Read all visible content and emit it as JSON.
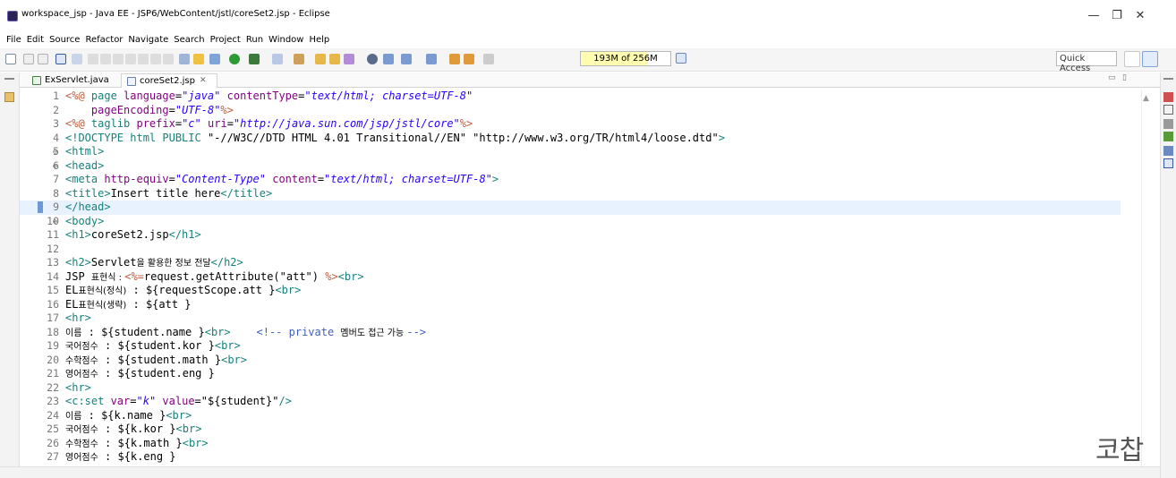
{
  "window": {
    "title": "workspace_jsp - Java EE - JSP6/WebContent/jstl/coreSet2.jsp - Eclipse",
    "minimize": "—",
    "maximize": "❐",
    "close": "✕"
  },
  "menu": [
    "File",
    "Edit",
    "Source",
    "Refactor",
    "Navigate",
    "Search",
    "Project",
    "Run",
    "Window",
    "Help"
  ],
  "toolbar": {
    "heap_status": "193M of 256M",
    "heap_fraction": 0.754,
    "quick_access": "Quick Access"
  },
  "tabs": [
    {
      "label": "ExServlet.java",
      "icon": "java-file-icon",
      "active": false
    },
    {
      "label": "coreSet2.jsp",
      "icon": "jsp-file-icon",
      "active": true,
      "close": "✕"
    }
  ],
  "editor": {
    "current_line": 9,
    "lines": [
      {
        "n": "1",
        "fold": "",
        "tokens": [
          [
            "jsp",
            "<%@ "
          ],
          [
            "tag",
            "page "
          ],
          [
            "attr",
            "language"
          ],
          [
            "plain",
            "="
          ],
          [
            "str",
            "\"java\""
          ],
          [
            "plain",
            " "
          ],
          [
            "attr",
            "contentType"
          ],
          [
            "plain",
            "="
          ],
          [
            "str",
            "\"text/html; charset=UTF-8\""
          ]
        ]
      },
      {
        "n": "2",
        "fold": "",
        "tokens": [
          [
            "plain",
            "    "
          ],
          [
            "attr",
            "pageEncoding"
          ],
          [
            "plain",
            "="
          ],
          [
            "str",
            "\"UTF-8\""
          ],
          [
            "jsp",
            "%>"
          ]
        ]
      },
      {
        "n": "3",
        "fold": "",
        "tokens": [
          [
            "jsp",
            "<%@ "
          ],
          [
            "tag",
            "taglib "
          ],
          [
            "attr",
            "prefix"
          ],
          [
            "plain",
            "="
          ],
          [
            "str",
            "\"c\""
          ],
          [
            "plain",
            " "
          ],
          [
            "attr",
            "uri"
          ],
          [
            "plain",
            "="
          ],
          [
            "str",
            "\"http://java.sun.com/jsp/jstl/core\""
          ],
          [
            "jsp",
            "%>"
          ]
        ]
      },
      {
        "n": "4",
        "fold": "",
        "tokens": [
          [
            "tag",
            "<!DOCTYPE html "
          ],
          [
            "tag",
            "PUBLIC "
          ],
          [
            "plain",
            "\"-//W3C//DTD HTML 4.01 Transitional//EN\" \"http://www.w3.org/TR/html4/loose.dtd\""
          ],
          [
            "tag",
            ">"
          ]
        ]
      },
      {
        "n": "5",
        "fold": "⊖",
        "tokens": [
          [
            "tag",
            "<html>"
          ]
        ]
      },
      {
        "n": "6",
        "fold": "⊖",
        "tokens": [
          [
            "tag",
            "<head>"
          ]
        ]
      },
      {
        "n": "7",
        "fold": "",
        "tokens": [
          [
            "tag",
            "<meta "
          ],
          [
            "attr",
            "http-equiv"
          ],
          [
            "plain",
            "="
          ],
          [
            "str",
            "\"Content-Type\""
          ],
          [
            "plain",
            " "
          ],
          [
            "attr",
            "content"
          ],
          [
            "plain",
            "="
          ],
          [
            "str",
            "\"text/html; charset=UTF-8\""
          ],
          [
            "tag",
            ">"
          ]
        ]
      },
      {
        "n": "8",
        "fold": "",
        "tokens": [
          [
            "tag",
            "<title>"
          ],
          [
            "plain",
            "Insert title here"
          ],
          [
            "tag",
            "</title>"
          ]
        ]
      },
      {
        "n": "9",
        "fold": "",
        "tokens": [
          [
            "tag",
            "</head>"
          ]
        ]
      },
      {
        "n": "10",
        "fold": "⊖",
        "tokens": [
          [
            "tag",
            "<body>"
          ]
        ]
      },
      {
        "n": "11",
        "fold": "",
        "tokens": [
          [
            "tag",
            "<h1>"
          ],
          [
            "plain",
            "coreSet2.jsp"
          ],
          [
            "tag",
            "</h1>"
          ]
        ]
      },
      {
        "n": "12",
        "fold": "",
        "tokens": []
      },
      {
        "n": "13",
        "fold": "",
        "tokens": [
          [
            "tag",
            "<h2>"
          ],
          [
            "plain",
            "Servlet"
          ],
          [
            "kr",
            "을 활용한 정보 전달"
          ],
          [
            "tag",
            "</h2>"
          ]
        ]
      },
      {
        "n": "14",
        "fold": "",
        "tokens": [
          [
            "plain",
            "JSP "
          ],
          [
            "kr",
            "표현식 : "
          ],
          [
            "jsp",
            "<%="
          ],
          [
            "plain",
            "request.getAttribute(\"att\") "
          ],
          [
            "jsp",
            "%>"
          ],
          [
            "tag",
            "<br>"
          ]
        ]
      },
      {
        "n": "15",
        "fold": "",
        "tokens": [
          [
            "plain",
            "EL"
          ],
          [
            "kr",
            "표현식(정식)"
          ],
          [
            "plain",
            " : ${requestScope.att }"
          ],
          [
            "tag",
            "<br>"
          ]
        ]
      },
      {
        "n": "16",
        "fold": "",
        "tokens": [
          [
            "plain",
            "EL"
          ],
          [
            "kr",
            "표현식(생략)"
          ],
          [
            "plain",
            " : ${att }"
          ]
        ]
      },
      {
        "n": "17",
        "fold": "",
        "tokens": [
          [
            "tag",
            "<hr>"
          ]
        ]
      },
      {
        "n": "18",
        "fold": "",
        "tokens": [
          [
            "kr",
            "이름"
          ],
          [
            "plain",
            " : ${student.name }"
          ],
          [
            "tag",
            "<br>"
          ],
          [
            "plain",
            "    "
          ],
          [
            "cmt",
            "<!-- private "
          ],
          [
            "kr",
            "멤버도 접근 가능 "
          ],
          [
            "cmt",
            "-->"
          ]
        ]
      },
      {
        "n": "19",
        "fold": "",
        "tokens": [
          [
            "kr",
            "국어점수"
          ],
          [
            "plain",
            " : ${student.kor }"
          ],
          [
            "tag",
            "<br>"
          ]
        ]
      },
      {
        "n": "20",
        "fold": "",
        "tokens": [
          [
            "kr",
            "수학점수"
          ],
          [
            "plain",
            " : ${student.math }"
          ],
          [
            "tag",
            "<br>"
          ]
        ]
      },
      {
        "n": "21",
        "fold": "",
        "tokens": [
          [
            "kr",
            "영어점수"
          ],
          [
            "plain",
            " : ${student.eng }"
          ]
        ]
      },
      {
        "n": "22",
        "fold": "",
        "tokens": [
          [
            "tag",
            "<hr>"
          ]
        ]
      },
      {
        "n": "23",
        "fold": "",
        "tokens": [
          [
            "tag",
            "<c:set "
          ],
          [
            "attr",
            "var"
          ],
          [
            "plain",
            "="
          ],
          [
            "str",
            "\"k\""
          ],
          [
            "plain",
            " "
          ],
          [
            "attr",
            "value"
          ],
          [
            "plain",
            "="
          ],
          [
            "plain",
            "\"${student}\""
          ],
          [
            "tag",
            "/>"
          ]
        ]
      },
      {
        "n": "24",
        "fold": "",
        "tokens": [
          [
            "kr",
            "이름"
          ],
          [
            "plain",
            " : ${k.name }"
          ],
          [
            "tag",
            "<br>"
          ]
        ]
      },
      {
        "n": "25",
        "fold": "",
        "tokens": [
          [
            "kr",
            "국어점수"
          ],
          [
            "plain",
            " : ${k.kor }"
          ],
          [
            "tag",
            "<br>"
          ]
        ]
      },
      {
        "n": "26",
        "fold": "",
        "tokens": [
          [
            "kr",
            "수학점수"
          ],
          [
            "plain",
            " : ${k.math }"
          ],
          [
            "tag",
            "<br>"
          ]
        ]
      },
      {
        "n": "27",
        "fold": "",
        "tokens": [
          [
            "kr",
            "영어점수"
          ],
          [
            "plain",
            " : ${k.eng }"
          ]
        ]
      }
    ]
  },
  "watermark": "코찹"
}
